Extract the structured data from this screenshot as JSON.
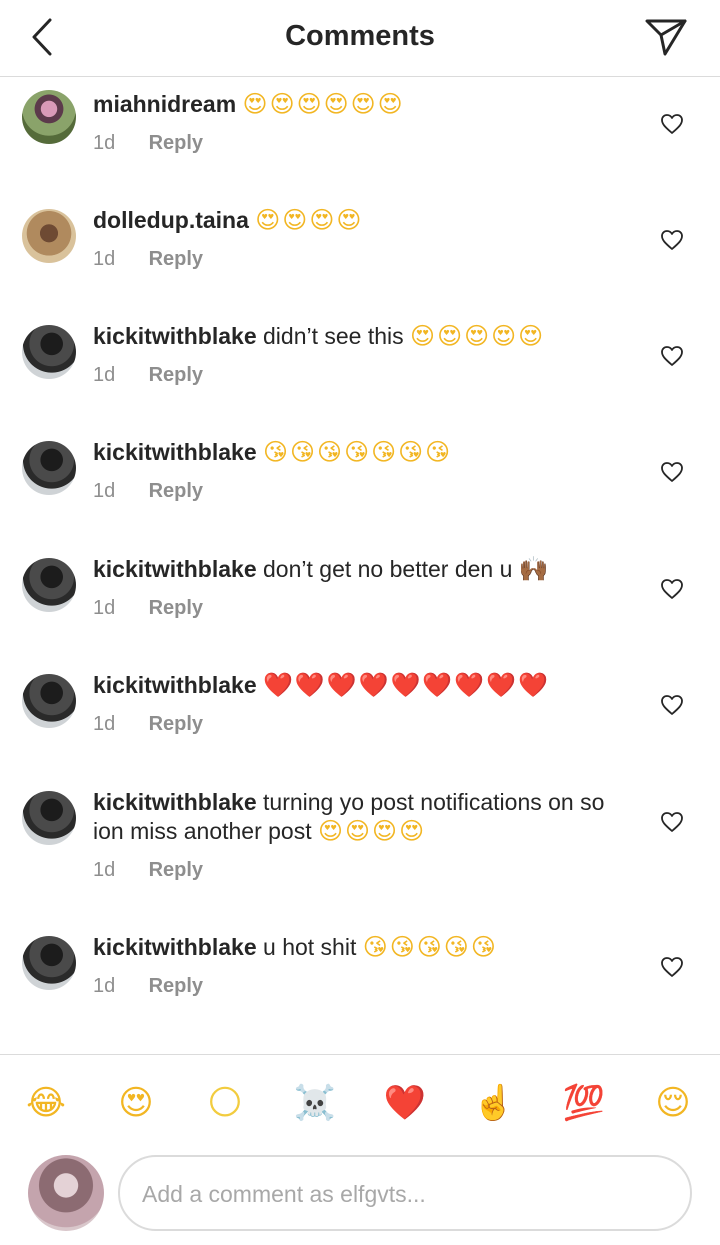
{
  "header": {
    "title": "Comments"
  },
  "comments": [
    {
      "username": "miahnidream",
      "text": "",
      "emoji": "😍😍😍😍😍😍",
      "emoji_color": "#f2b623",
      "time": "1d",
      "reply": "Reply"
    },
    {
      "username": "dolledup.taina",
      "text": "",
      "emoji": "😍😍😍😍",
      "emoji_color": "#f2b623",
      "time": "1d",
      "reply": "Reply"
    },
    {
      "username": "kickitwithblake",
      "text": "didn’t see this",
      "emoji": "😍😍😍😍😍",
      "emoji_color": "#f2b623",
      "time": "1d",
      "reply": "Reply"
    },
    {
      "username": "kickitwithblake",
      "text": "",
      "emoji": "😘😘😘😘😘😘😘",
      "emoji_color": "#f2b623",
      "time": "1d",
      "reply": "Reply"
    },
    {
      "username": "kickitwithblake",
      "text": "don’t get no better den u",
      "emoji": "🙌🏾",
      "emoji_color": "#8a5a34",
      "time": "1d",
      "reply": "Reply"
    },
    {
      "username": "kickitwithblake",
      "text": "",
      "emoji": "❤️❤️❤️❤️❤️❤️❤️❤️❤️",
      "emoji_color": "#ef3b2a",
      "time": "1d",
      "reply": "Reply"
    },
    {
      "username": "kickitwithblake",
      "text": "turning yo post notifications on so ion miss another post",
      "emoji": "😍😍😍😍",
      "emoji_color": "#f2b623",
      "time": "1d",
      "reply": "Reply"
    },
    {
      "username": "kickitwithblake",
      "text": "u hot shit",
      "emoji": "😘😘😘😘😘",
      "emoji_color": "#f2b623",
      "time": "1d",
      "reply": "Reply"
    }
  ],
  "quick_emojis": [
    "😂",
    "😍",
    "🌕",
    "☠️",
    "❤️",
    "☝️",
    "💯",
    "😌"
  ],
  "quick_emoji_colors": [
    "#f2b623",
    "#f2b623",
    "#f2cc3f",
    "#555555",
    "#ef3b2a",
    "#f2c9a0",
    "#e0242f",
    "#f2b623"
  ],
  "composer": {
    "placeholder": "Add a comment as elfgvts..."
  },
  "icons": {
    "back": "chevron-left-icon",
    "share": "paper-plane-icon",
    "like": "heart-outline-icon"
  }
}
